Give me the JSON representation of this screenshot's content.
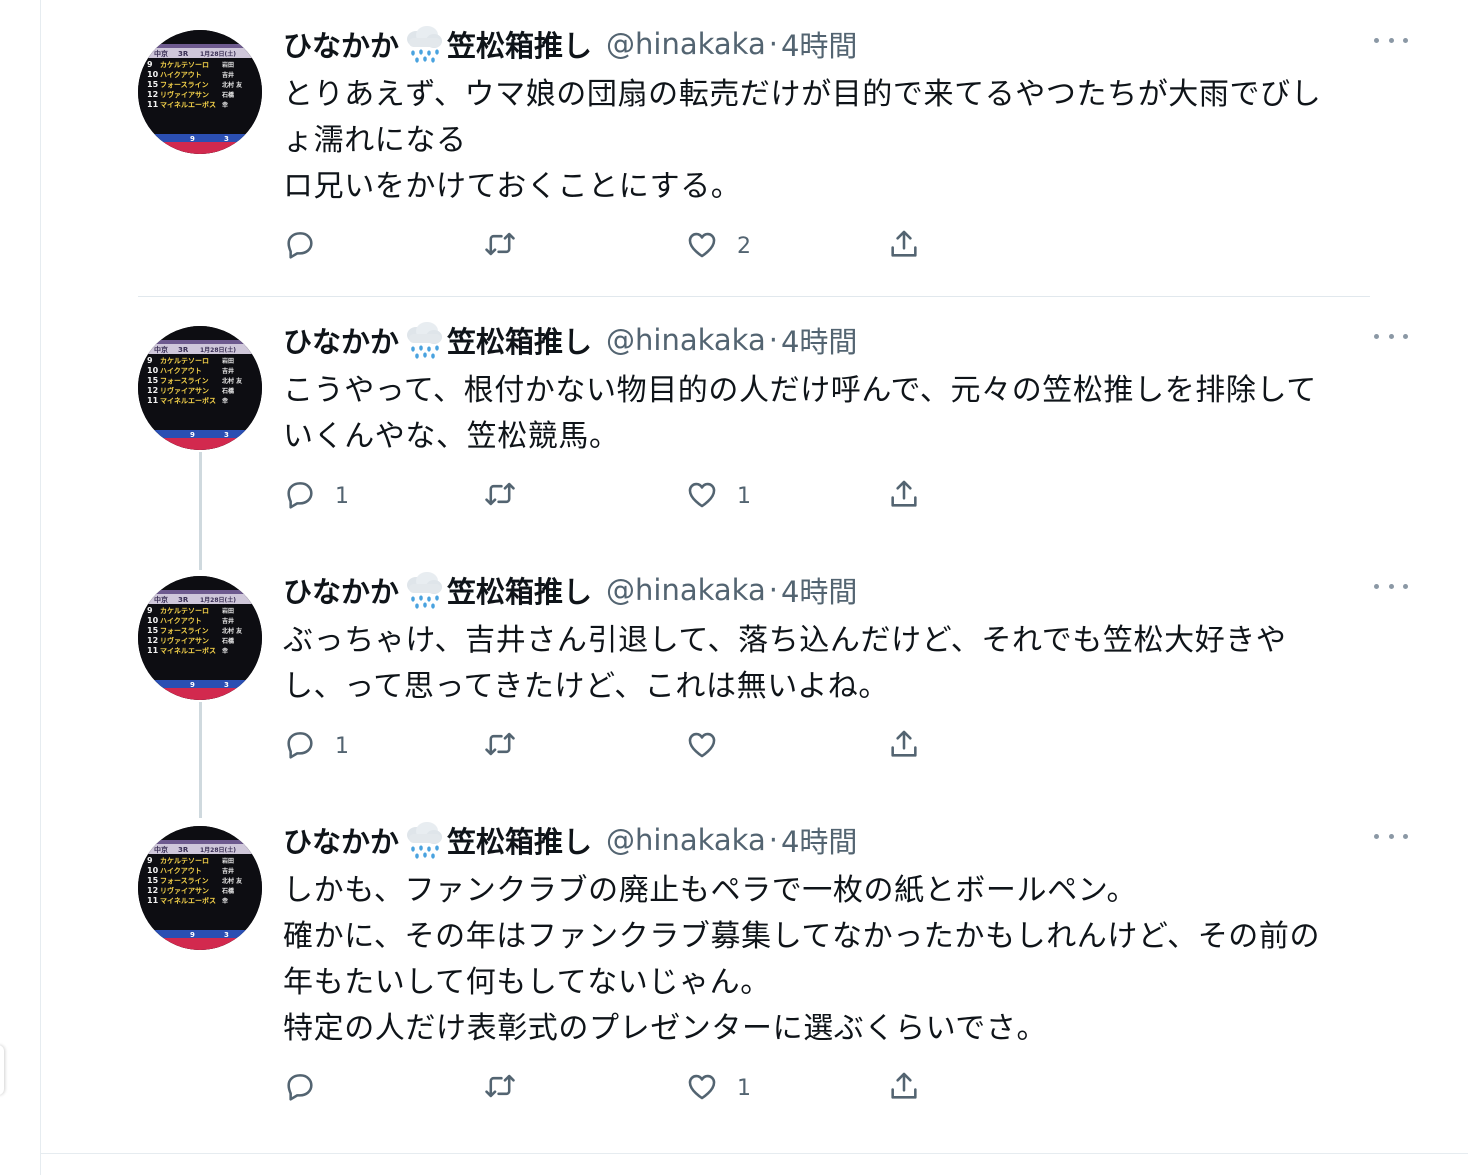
{
  "tweets": [
    {
      "author": {
        "name_pre": "ひなかか",
        "name_post": "笠松箱推し",
        "name_emoji": "cloud-rain-icon",
        "handle": "@hinakaka",
        "separator": "·",
        "time": "4時間"
      },
      "lines": [
        "とりあえず、ウマ娘の団扇の転売だけが目的で来てるやつたちが大雨でびし",
        "ょ濡れになる",
        "ロ兄いをかけておくことにする。"
      ],
      "counts": {
        "reply": "",
        "retweet": "",
        "like": "2"
      }
    },
    {
      "author": {
        "name_pre": "ひなかか",
        "name_post": "笠松箱推し",
        "name_emoji": "cloud-rain-icon",
        "handle": "@hinakaka",
        "separator": "·",
        "time": "4時間"
      },
      "lines": [
        "こうやって、根付かない物目的の人だけ呼んで、元々の笠松推しを排除して",
        "いくんやな、笠松競馬。"
      ],
      "counts": {
        "reply": "1",
        "retweet": "",
        "like": "1"
      }
    },
    {
      "author": {
        "name_pre": "ひなかか",
        "name_post": "笠松箱推し",
        "name_emoji": "cloud-rain-icon",
        "handle": "@hinakaka",
        "separator": "·",
        "time": "4時間"
      },
      "lines": [
        "ぶっちゃけ、吉井さん引退して、落ち込んだけど、それでも笠松大好きや",
        "し、って思ってきたけど、これは無いよね。"
      ],
      "counts": {
        "reply": "1",
        "retweet": "",
        "like": ""
      }
    },
    {
      "author": {
        "name_pre": "ひなかか",
        "name_post": "笠松箱推し",
        "name_emoji": "cloud-rain-icon",
        "handle": "@hinakaka",
        "separator": "·",
        "time": "4時間"
      },
      "lines": [
        "しかも、ファンクラブの廃止もペラで一枚の紙とボールペン。",
        "確かに、その年はファンクラブ募集してなかったかもしれんけど、その前の",
        "年もたいして何もしてないじゃん。",
        "特定の人だけ表彰式のプレゼンターに選ぶくらいでさ。"
      ],
      "counts": {
        "reply": "",
        "retweet": "",
        "like": "1"
      }
    }
  ],
  "avatar_tv": {
    "header": [
      "中京",
      "3R",
      "1月28日(土)"
    ],
    "rows": [
      {
        "num": "9",
        "horse": "カケルテソーロ",
        "jockey": "岩田"
      },
      {
        "num": "10",
        "horse": "ハイクアウト",
        "jockey": "吉井"
      },
      {
        "num": "15",
        "horse": "フォースライン",
        "jockey": "北村 友"
      },
      {
        "num": "12",
        "horse": "リヴァイアサン",
        "jockey": "石橋"
      },
      {
        "num": "11",
        "horse": "マイネルエーボス",
        "jockey": "幸"
      }
    ],
    "bottom": [
      "9",
      "3"
    ]
  }
}
